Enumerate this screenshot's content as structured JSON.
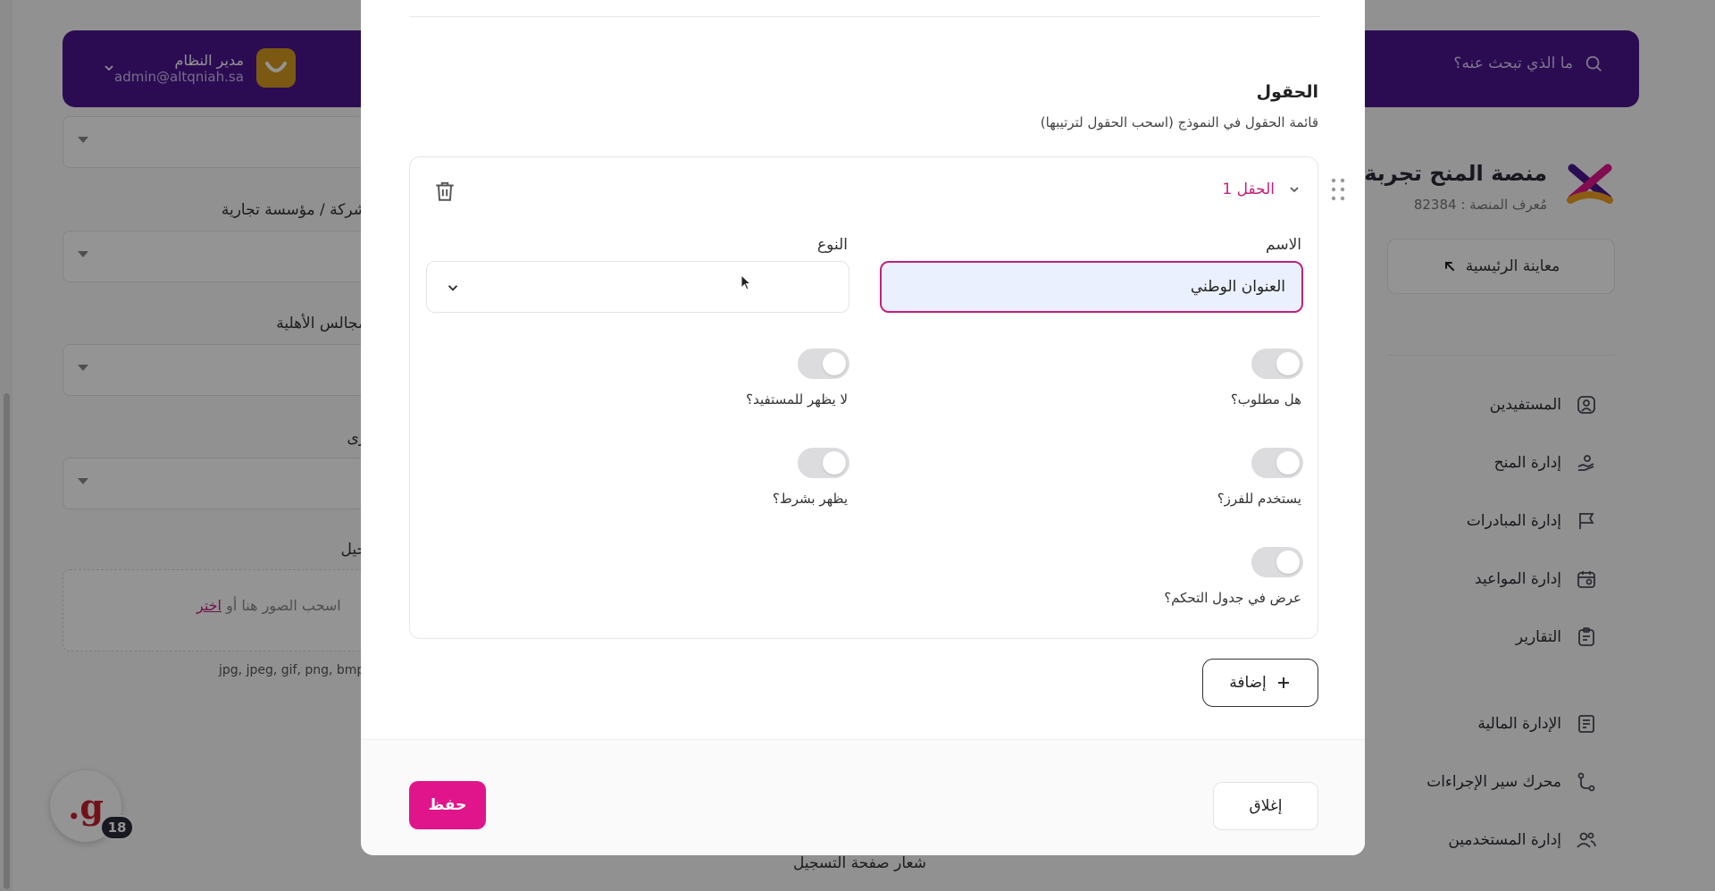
{
  "topbar": {
    "search_placeholder": "ما الذي تبحث عنه؟",
    "user_name": "مدير النظام",
    "user_email": "admin@altqniah.sa"
  },
  "brand": {
    "title": "منصة المنح تجربة",
    "platform_id": "مُعرف المنصة : 82384"
  },
  "sidebar": {
    "preview_label": "معاينة الرئيسية",
    "items": [
      {
        "label": "المستفيدين",
        "icon": "user-square-icon"
      },
      {
        "label": "إدارة المنح",
        "icon": "hand-user-icon"
      },
      {
        "label": "إدارة المبادرات",
        "icon": "flag-icon"
      },
      {
        "label": "إدارة المواعيد",
        "icon": "calendar-icon"
      },
      {
        "label": "التقارير",
        "icon": "report-icon"
      },
      {
        "label": "الإدارة المالية",
        "icon": "finance-icon"
      },
      {
        "label": "محرك سير الإجراءات",
        "icon": "workflow-icon"
      },
      {
        "label": "إدارة المستخدمين",
        "icon": "users-icon"
      }
    ]
  },
  "background_form": {
    "label_company": "شركة / مؤسسة تجارية",
    "label_councils": "مجالس الأهلية",
    "label_other": "رى",
    "label_registration": "جيل",
    "drop_text": "اسحب الصور هنا أو",
    "drop_pick": "اختر",
    "formats": "jpg, jpeg, gif, png, bmp,",
    "bottom_label": "شعار صفحة التسجيل"
  },
  "fab": {
    "letter": "g.",
    "badge": "18"
  },
  "modal": {
    "section_title": "الحقول",
    "section_subtitle": "قائمة الحقول في النموذج (اسحب الحقول لترتيبها)",
    "field": {
      "title": "الحقل 1",
      "name_label": "الاسم",
      "name_value": "العنوان الوطني",
      "type_label": "النوع",
      "toggles": {
        "required": "هل مطلوب؟",
        "hidden_from_beneficiary": "لا يظهر للمستفيد؟",
        "used_for_sorting": "يستخدم للفرز؟",
        "conditional": "يظهر بشرط؟",
        "show_in_dashboard": "عرض في جدول التحكم؟"
      }
    },
    "add_label": "إضافة",
    "close_label": "إغلاق",
    "save_label": "حفظ"
  },
  "colors": {
    "brand_purple": "#4a1590",
    "accent_pink": "#e0158c",
    "toggle_off": "#dcdcdf"
  }
}
